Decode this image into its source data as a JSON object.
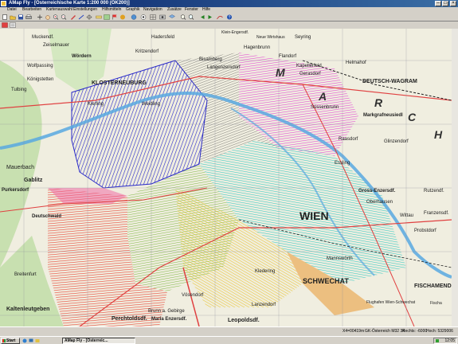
{
  "window": {
    "title": "AMap Fly - [Österreichische Karte 1:200 000 (ÖK200)]",
    "colors": {
      "titlebar": "#0a246a",
      "chrome": "#d4d0c8"
    }
  },
  "menu": [
    {
      "label": "Datei"
    },
    {
      "label": "Bearbeiten"
    },
    {
      "label": "Kartenauswahl"
    },
    {
      "label": "Einstellungen"
    },
    {
      "label": "Hilfsmitteln"
    },
    {
      "label": "Graphik"
    },
    {
      "label": "Navigation"
    },
    {
      "label": "Zusätze"
    },
    {
      "label": "Fenster"
    },
    {
      "label": "Hilfe"
    }
  ],
  "toolbar": {
    "icons": [
      "new-icon",
      "open-icon",
      "save-icon",
      "print-icon",
      "move-icon",
      "hand-icon",
      "zoom-in-icon",
      "zoom-out-icon",
      "pen-icon",
      "line-icon",
      "crosshair-icon",
      "ruler-icon",
      "map-icon",
      "flag-icon",
      "info-icon",
      "globe-icon",
      "target-icon",
      "grid-icon",
      "photo-icon",
      "layers-icon",
      "zoom-fit-icon",
      "zoom-select-icon",
      "back-icon",
      "forward-icon",
      "track-icon",
      "help-icon"
    ]
  },
  "map": {
    "region_labels": [
      {
        "text": "KLOSTERNEUBURG"
      },
      {
        "text": "DEUTSCH-WAGRAM"
      },
      {
        "text": "WIEN"
      },
      {
        "text": "SCHWECHAT"
      },
      {
        "text": "FISCHAMEND"
      },
      {
        "text": "Perchtoldsdf."
      },
      {
        "text": "Kaltenleutgeben"
      },
      {
        "text": "Breitenfurt"
      },
      {
        "text": "Mauerbach"
      },
      {
        "text": "Gablitz"
      },
      {
        "text": "Purkersdorf"
      },
      {
        "text": "Deutschwald"
      },
      {
        "text": "Muckendf."
      },
      {
        "text": "Zeiselmauer"
      },
      {
        "text": "Wolfpassing"
      },
      {
        "text": "Königstetten"
      },
      {
        "text": "Tulbing"
      },
      {
        "text": "Bisamberg"
      },
      {
        "text": "Langenzersdorf"
      },
      {
        "text": "Hagenbrunn"
      },
      {
        "text": "Seyring"
      },
      {
        "text": "Flandorf"
      },
      {
        "text": "Kapellerfeld"
      },
      {
        "text": "Gerasdorf"
      },
      {
        "text": "Helmahof"
      },
      {
        "text": "Markgrafneusiedl"
      },
      {
        "text": "Glinzendorf"
      },
      {
        "text": "Gross-Enzersdf."
      },
      {
        "text": "Raasdorf"
      },
      {
        "text": "Rutzendf."
      },
      {
        "text": "Franzensdf."
      },
      {
        "text": "Wittau"
      },
      {
        "text": "Probstdorf"
      },
      {
        "text": "Oberhausen"
      },
      {
        "text": "Mannswörth"
      },
      {
        "text": "Kledering"
      },
      {
        "text": "Vösendorf"
      },
      {
        "text": "Lanzendorf"
      },
      {
        "text": "Leopoldsdf."
      },
      {
        "text": "Brunn a. Gebirge"
      },
      {
        "text": "Maria Enzersdf."
      },
      {
        "text": "Essling"
      },
      {
        "text": "Süssenbrunn"
      },
      {
        "text": "Wördern"
      },
      {
        "text": "Kritzendorf"
      },
      {
        "text": "Weidling"
      },
      {
        "text": "Hadersfeld"
      },
      {
        "text": "Kierling"
      },
      {
        "text": "Neue Wirtshaus"
      },
      {
        "text": "Klein-Engersdf."
      },
      {
        "text": "Flughafen Wien-Schwechat"
      },
      {
        "text": "Fischa"
      }
    ],
    "marsh_letters": [
      "M",
      "A",
      "R",
      "C",
      "H"
    ],
    "colors": {
      "background": "#eef0e4",
      "danube": "#58a8e0",
      "zone_blue": "#2828c8",
      "zone_magenta": "#e030d0",
      "zone_cyan": "#28c8c0",
      "zone_green": "#70b030",
      "zone_yellow": "#e8c020",
      "zone_red": "#e83020",
      "zone_orange": "#e89020",
      "zone_dark": "#303030",
      "zone_pink": "#f060a0",
      "roads": "#e04040"
    }
  },
  "statusbar": {
    "fields": [
      {
        "text": "X4=00419m"
      },
      {
        "text": "GK-Österreich  M32  34"
      },
      {
        "text": "Rechts: -6000"
      },
      {
        "text": "Hoch: 5329006"
      }
    ]
  },
  "taskbar": {
    "start_label": "Start",
    "buttons": [
      {
        "label": "AMap Fly - [Österreic..."
      }
    ],
    "clock": "12:05"
  }
}
